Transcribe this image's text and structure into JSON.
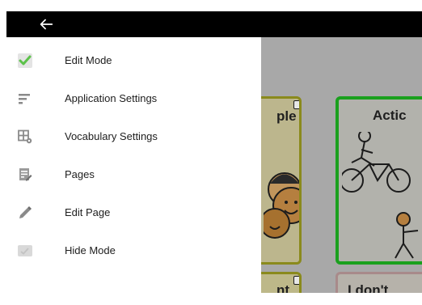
{
  "drawer": {
    "items": [
      {
        "label": "Edit Mode",
        "icon": "checkmark-icon"
      },
      {
        "label": "Application Settings",
        "icon": "sort-lines-icon"
      },
      {
        "label": "Vocabulary Settings",
        "icon": "grid-settings-icon"
      },
      {
        "label": "Pages",
        "icon": "pages-edit-icon"
      },
      {
        "label": "Edit Page",
        "icon": "pencil-icon"
      },
      {
        "label": "Hide Mode",
        "icon": "hide-icon"
      }
    ]
  },
  "board": {
    "tiles": [
      {
        "label": "ple"
      },
      {
        "label": "Actic"
      },
      {
        "label": "nt"
      },
      {
        "label": "I don't"
      }
    ]
  },
  "colors": {
    "check_green": "#5cc24a",
    "top_bar": "#000000",
    "overlay_gray": "#a8a8a8"
  }
}
